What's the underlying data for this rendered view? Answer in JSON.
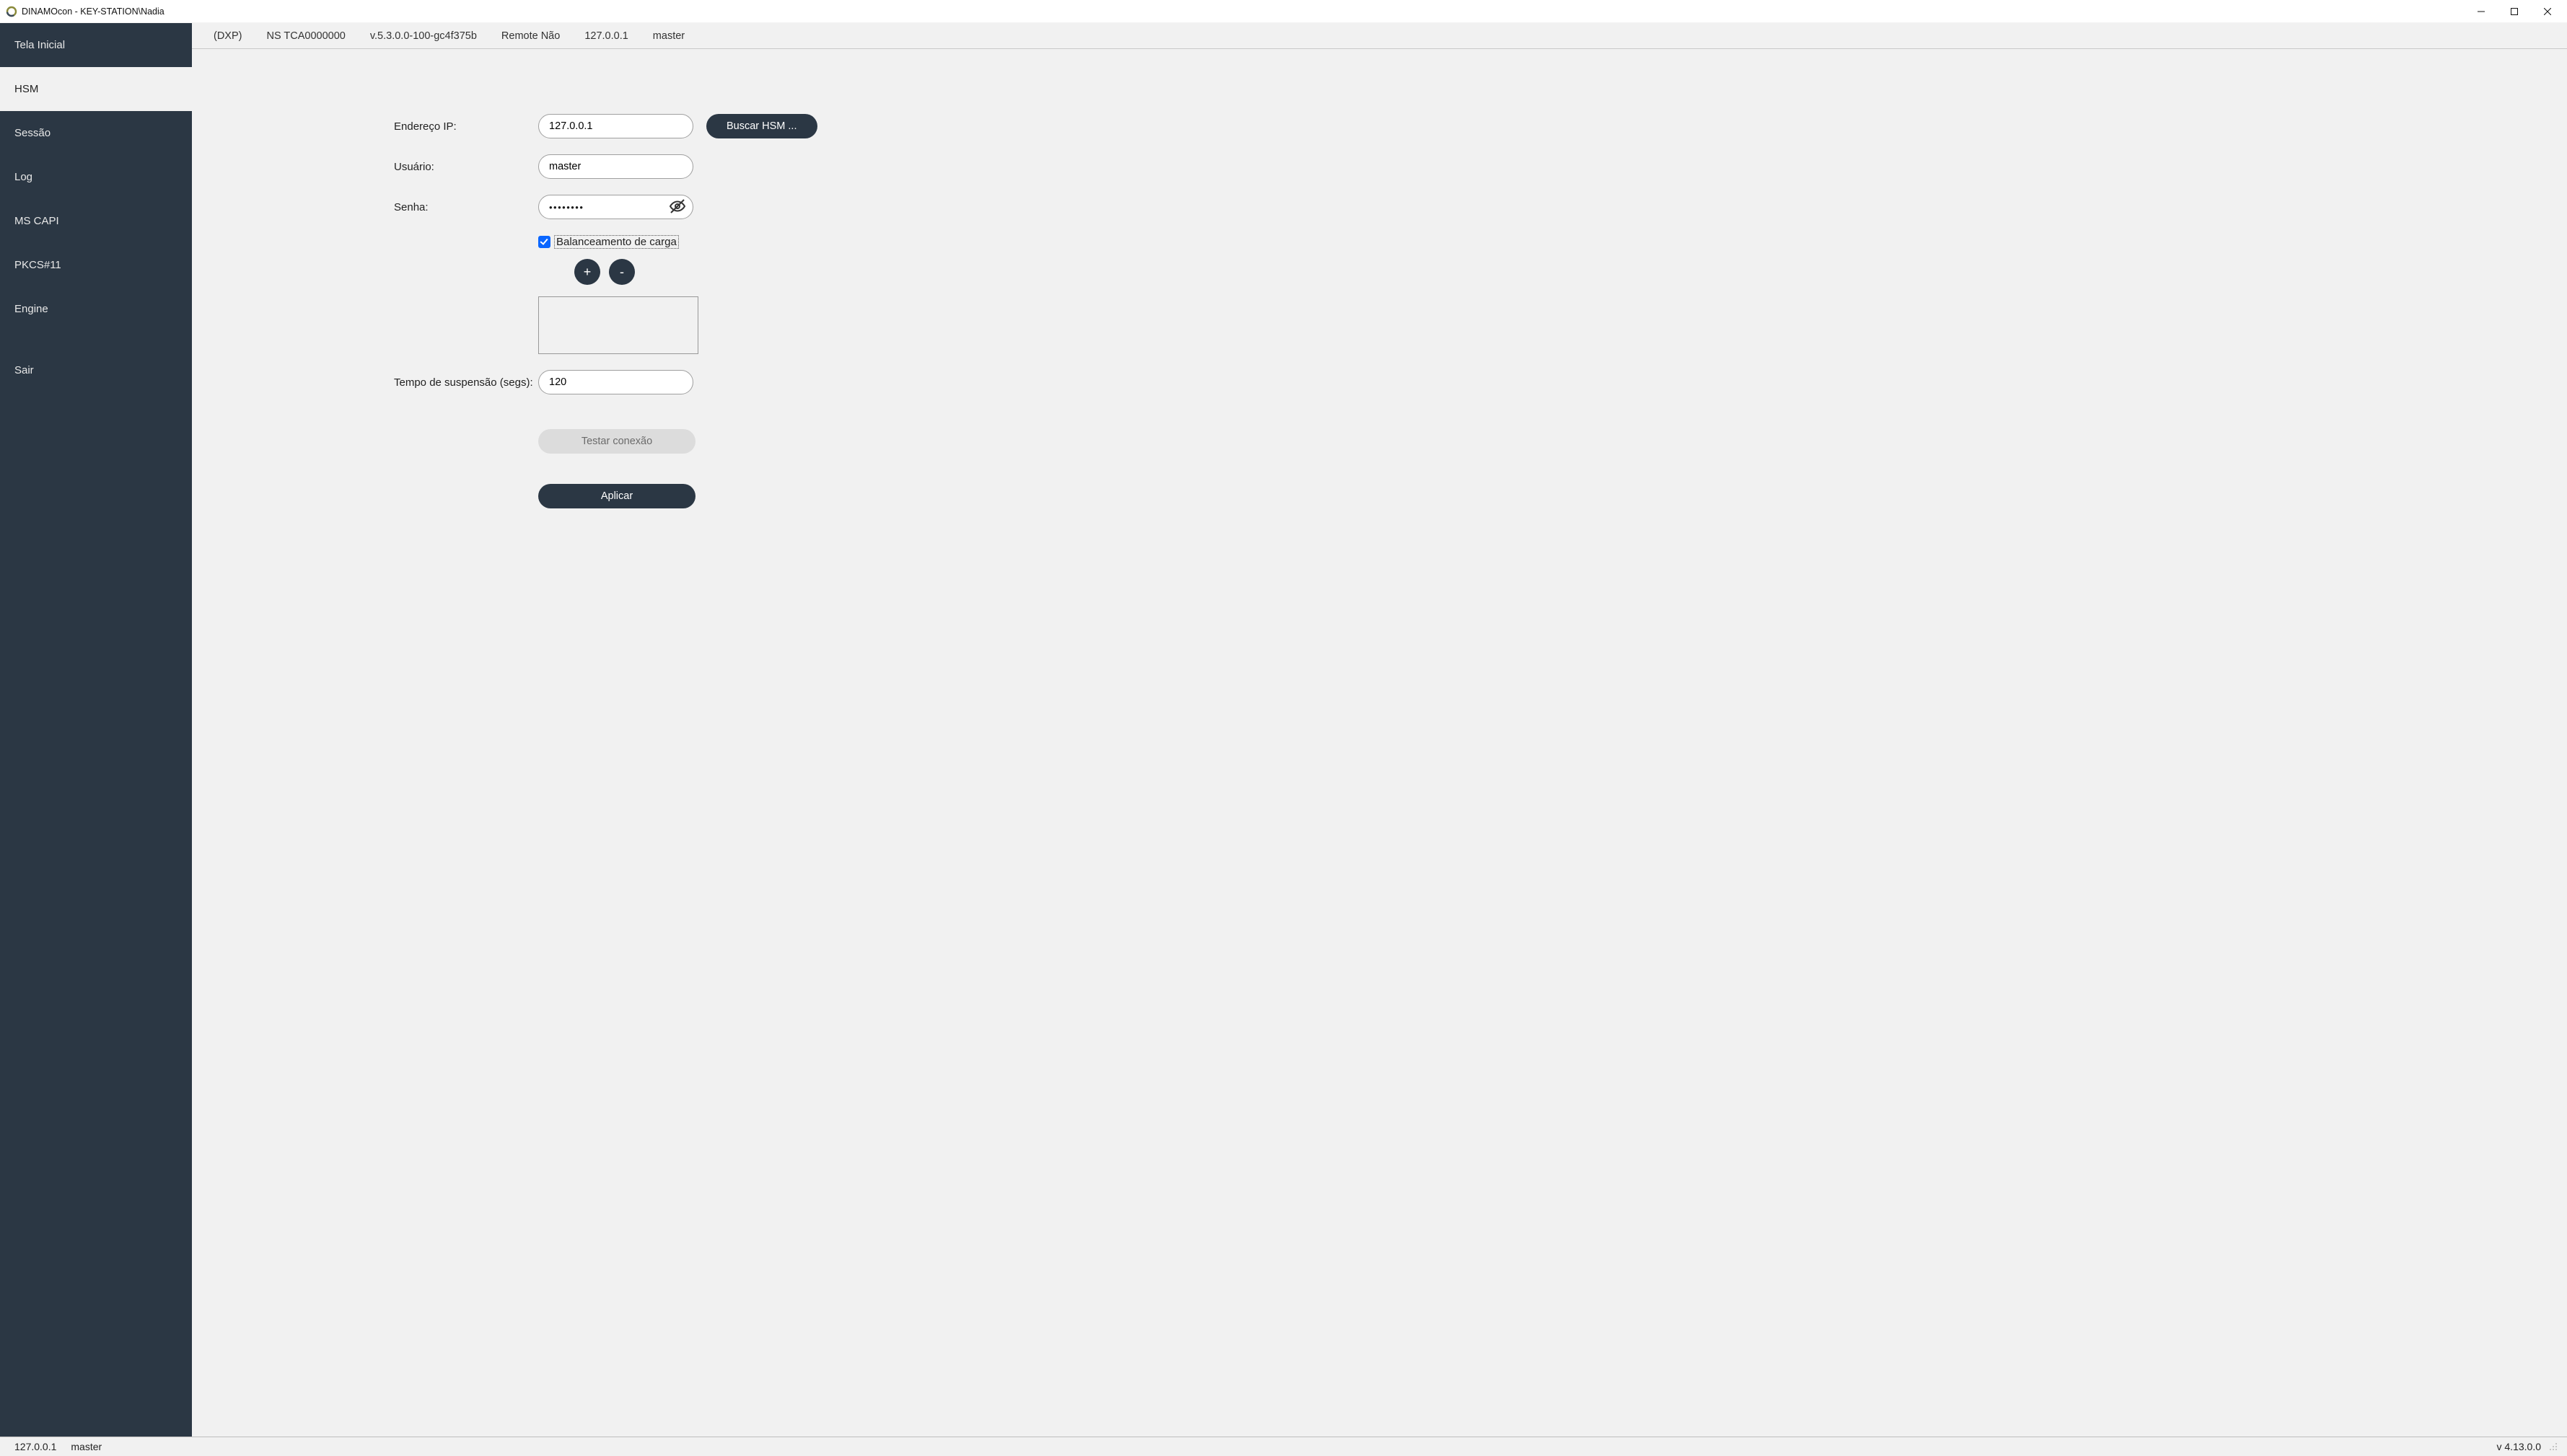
{
  "titlebar": {
    "title": "DINAMOcon - KEY-STATION\\Nadia"
  },
  "sidebar": {
    "items": [
      {
        "label": "Tela Inicial",
        "active": false
      },
      {
        "label": "HSM",
        "active": true
      },
      {
        "label": "Sessão",
        "active": false
      },
      {
        "label": "Log",
        "active": false
      },
      {
        "label": "MS CAPI",
        "active": false
      },
      {
        "label": "PKCS#11",
        "active": false
      },
      {
        "label": "Engine",
        "active": false
      },
      {
        "label": "Sair",
        "active": false
      }
    ]
  },
  "infobar": {
    "model": "(DXP)",
    "serial": "NS TCA0000000",
    "version": "v.5.3.0.0-100-gc4f375b",
    "remote": "Remote Não",
    "ip": "127.0.0.1",
    "user": "master"
  },
  "form": {
    "ip_label": "Endereço IP:",
    "ip_value": "127.0.0.1",
    "search_hsm_label": "Buscar HSM ...",
    "user_label": "Usuário:",
    "user_value": "master",
    "password_label": "Senha:",
    "password_masked": "••••••••",
    "load_balance_label": "Balanceamento de carga",
    "load_balance_checked": true,
    "add_label": "+",
    "remove_label": "-",
    "suspend_label": "Tempo de suspensão (segs):",
    "suspend_value": "120",
    "test_label": "Testar conexão",
    "apply_label": "Aplicar"
  },
  "statusbar": {
    "ip": "127.0.0.1",
    "user": "master",
    "version": "v 4.13.0.0"
  }
}
